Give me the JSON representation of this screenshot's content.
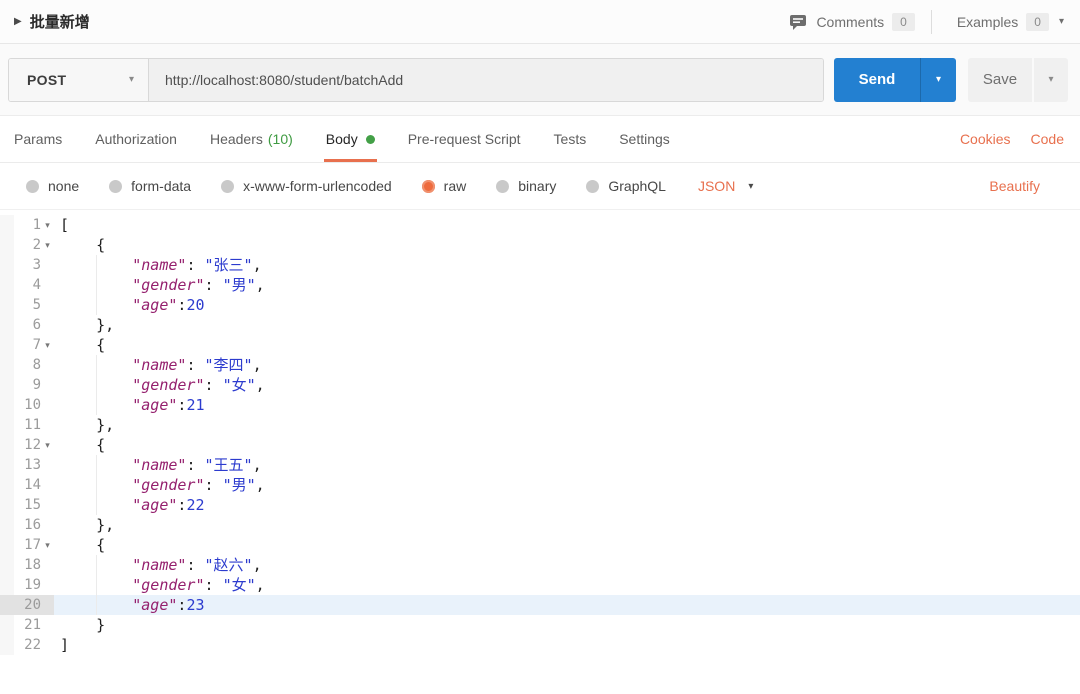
{
  "header": {
    "title": "批量新增",
    "comments_label": "Comments",
    "comments_count": "0",
    "examples_label": "Examples",
    "examples_count": "0"
  },
  "request": {
    "method": "POST",
    "url": "http://localhost:8080/student/batchAdd",
    "send_label": "Send",
    "save_label": "Save"
  },
  "tabs": {
    "items": [
      {
        "label": "Params",
        "active": false,
        "dot": false,
        "suffix": ""
      },
      {
        "label": "Authorization",
        "active": false,
        "dot": false,
        "suffix": ""
      },
      {
        "label": "Headers",
        "active": false,
        "dot": false,
        "suffix": "(10)"
      },
      {
        "label": "Body",
        "active": true,
        "dot": true,
        "suffix": ""
      },
      {
        "label": "Pre-request Script",
        "active": false,
        "dot": false,
        "suffix": ""
      },
      {
        "label": "Tests",
        "active": false,
        "dot": false,
        "suffix": ""
      },
      {
        "label": "Settings",
        "active": false,
        "dot": false,
        "suffix": ""
      }
    ],
    "links": [
      "Cookies",
      "Code"
    ]
  },
  "body_options": {
    "radios": [
      {
        "label": "none",
        "selected": false
      },
      {
        "label": "form-data",
        "selected": false
      },
      {
        "label": "x-www-form-urlencoded",
        "selected": false
      },
      {
        "label": "raw",
        "selected": true
      },
      {
        "label": "binary",
        "selected": false
      },
      {
        "label": "GraphQL",
        "selected": false
      }
    ],
    "format_select": "JSON",
    "beautify_label": "Beautify"
  },
  "editor": {
    "lines": [
      {
        "n": 1,
        "fold": true,
        "hl": false,
        "guide": false,
        "seg": [
          [
            "p",
            "["
          ]
        ]
      },
      {
        "n": 2,
        "fold": true,
        "hl": false,
        "guide": false,
        "seg": [
          [
            "p",
            "    {"
          ]
        ]
      },
      {
        "n": 3,
        "fold": false,
        "hl": false,
        "guide": true,
        "seg": [
          [
            "p",
            "        "
          ],
          [
            "k",
            "\"name\""
          ],
          [
            "p",
            ": "
          ],
          [
            "s",
            "\"张三\""
          ],
          [
            "p",
            ","
          ]
        ]
      },
      {
        "n": 4,
        "fold": false,
        "hl": false,
        "guide": true,
        "seg": [
          [
            "p",
            "        "
          ],
          [
            "k",
            "\"gender\""
          ],
          [
            "p",
            ": "
          ],
          [
            "s",
            "\"男\""
          ],
          [
            "p",
            ","
          ]
        ]
      },
      {
        "n": 5,
        "fold": false,
        "hl": false,
        "guide": true,
        "seg": [
          [
            "p",
            "        "
          ],
          [
            "k",
            "\"age\""
          ],
          [
            "p",
            ":"
          ],
          [
            "n",
            "20"
          ]
        ]
      },
      {
        "n": 6,
        "fold": false,
        "hl": false,
        "guide": false,
        "seg": [
          [
            "p",
            "    },"
          ]
        ]
      },
      {
        "n": 7,
        "fold": true,
        "hl": false,
        "guide": false,
        "seg": [
          [
            "p",
            "    {"
          ]
        ]
      },
      {
        "n": 8,
        "fold": false,
        "hl": false,
        "guide": true,
        "seg": [
          [
            "p",
            "        "
          ],
          [
            "k",
            "\"name\""
          ],
          [
            "p",
            ": "
          ],
          [
            "s",
            "\"李四\""
          ],
          [
            "p",
            ","
          ]
        ]
      },
      {
        "n": 9,
        "fold": false,
        "hl": false,
        "guide": true,
        "seg": [
          [
            "p",
            "        "
          ],
          [
            "k",
            "\"gender\""
          ],
          [
            "p",
            ": "
          ],
          [
            "s",
            "\"女\""
          ],
          [
            "p",
            ","
          ]
        ]
      },
      {
        "n": 10,
        "fold": false,
        "hl": false,
        "guide": true,
        "seg": [
          [
            "p",
            "        "
          ],
          [
            "k",
            "\"age\""
          ],
          [
            "p",
            ":"
          ],
          [
            "n",
            "21"
          ]
        ]
      },
      {
        "n": 11,
        "fold": false,
        "hl": false,
        "guide": false,
        "seg": [
          [
            "p",
            "    },"
          ]
        ]
      },
      {
        "n": 12,
        "fold": true,
        "hl": false,
        "guide": false,
        "seg": [
          [
            "p",
            "    {"
          ]
        ]
      },
      {
        "n": 13,
        "fold": false,
        "hl": false,
        "guide": true,
        "seg": [
          [
            "p",
            "        "
          ],
          [
            "k",
            "\"name\""
          ],
          [
            "p",
            ": "
          ],
          [
            "s",
            "\"王五\""
          ],
          [
            "p",
            ","
          ]
        ]
      },
      {
        "n": 14,
        "fold": false,
        "hl": false,
        "guide": true,
        "seg": [
          [
            "p",
            "        "
          ],
          [
            "k",
            "\"gender\""
          ],
          [
            "p",
            ": "
          ],
          [
            "s",
            "\"男\""
          ],
          [
            "p",
            ","
          ]
        ]
      },
      {
        "n": 15,
        "fold": false,
        "hl": false,
        "guide": true,
        "seg": [
          [
            "p",
            "        "
          ],
          [
            "k",
            "\"age\""
          ],
          [
            "p",
            ":"
          ],
          [
            "n",
            "22"
          ]
        ]
      },
      {
        "n": 16,
        "fold": false,
        "hl": false,
        "guide": false,
        "seg": [
          [
            "p",
            "    },"
          ]
        ]
      },
      {
        "n": 17,
        "fold": true,
        "hl": false,
        "guide": false,
        "seg": [
          [
            "p",
            "    {"
          ]
        ]
      },
      {
        "n": 18,
        "fold": false,
        "hl": false,
        "guide": true,
        "seg": [
          [
            "p",
            "        "
          ],
          [
            "k",
            "\"name\""
          ],
          [
            "p",
            ": "
          ],
          [
            "s",
            "\"赵六\""
          ],
          [
            "p",
            ","
          ]
        ]
      },
      {
        "n": 19,
        "fold": false,
        "hl": false,
        "guide": true,
        "seg": [
          [
            "p",
            "        "
          ],
          [
            "k",
            "\"gender\""
          ],
          [
            "p",
            ": "
          ],
          [
            "s",
            "\"女\""
          ],
          [
            "p",
            ","
          ]
        ]
      },
      {
        "n": 20,
        "fold": false,
        "hl": true,
        "guide": true,
        "seg": [
          [
            "p",
            "        "
          ],
          [
            "k",
            "\"age\""
          ],
          [
            "p",
            ":"
          ],
          [
            "n",
            "23"
          ]
        ]
      },
      {
        "n": 21,
        "fold": false,
        "hl": false,
        "guide": false,
        "seg": [
          [
            "p",
            "    }"
          ]
        ]
      },
      {
        "n": 22,
        "fold": false,
        "hl": false,
        "guide": false,
        "seg": [
          [
            "p",
            "]"
          ]
        ]
      }
    ]
  },
  "colors": {
    "accent_orange": "#e8704e",
    "send_blue": "#2380d1",
    "status_green": "#43a047",
    "token_key": "#941f6d",
    "token_value": "#2c3bce",
    "line_highlight": "#e9f2fb"
  }
}
